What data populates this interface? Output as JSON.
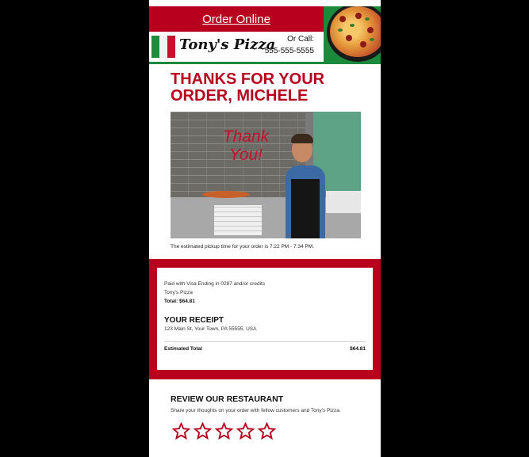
{
  "header": {
    "order_online": "Order Online",
    "brand_name": "Tony's Pizza",
    "call_label": "Or Call:",
    "phone": "555-555-5555"
  },
  "thanks": {
    "title": "THANKS FOR YOUR ORDER, MICHELE",
    "photo_text_line1": "Thank",
    "photo_text_line2": "You!",
    "pickup_text": "The estimated pickup time for your order is 7:22 PM - 7:34 PM."
  },
  "receipt": {
    "paid_with": "Paid with Visa Ending in 0287 and/or credits",
    "store": "Tony's Pizza",
    "total": "Total: $64.81",
    "title": "YOUR RECEIPT",
    "address": "123 Main St, Your Town, PA 55555, USA",
    "estimated_total_label": "Estimated Total",
    "estimated_total_value": "$64.81"
  },
  "review": {
    "title": "REVIEW OUR RESTAURANT",
    "subtitle": "Share your thoughts on your order with fellow customers and Tony's Pizza.",
    "star_count": 5
  },
  "colors": {
    "brand_red": "#b8001e",
    "brand_green": "#1b8a3a",
    "background": "#000000"
  }
}
